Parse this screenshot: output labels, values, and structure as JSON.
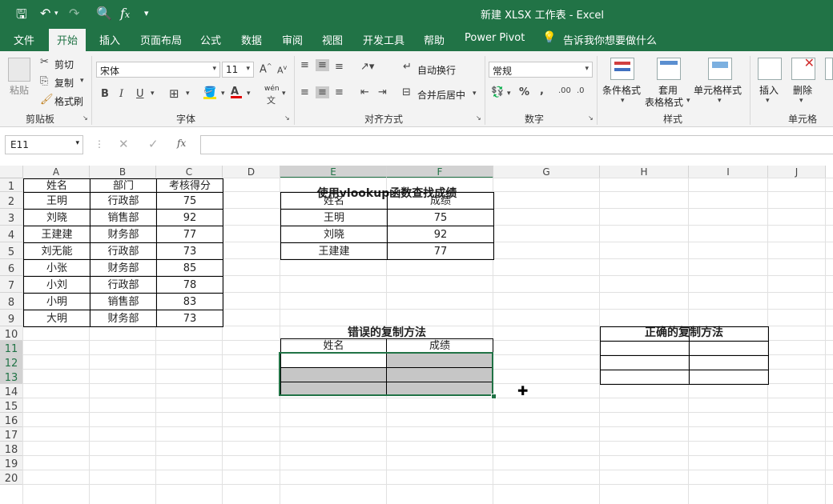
{
  "titlebar": {
    "title": "新建 XLSX 工作表  -  Excel",
    "icons": [
      "save-icon",
      "undo-icon",
      "redo-icon",
      "print-preview-icon",
      "fx-icon",
      "customize-icon"
    ]
  },
  "tabs": [
    "文件",
    "开始",
    "插入",
    "页面布局",
    "公式",
    "数据",
    "审阅",
    "视图",
    "开发工具",
    "帮助",
    "Power Pivot"
  ],
  "active_tab": "开始",
  "tell_me": "告诉我你想要做什么",
  "ribbon": {
    "clipboard": {
      "paste": "粘贴",
      "cut": "剪切",
      "copy": "复制",
      "format_painter": "格式刷",
      "group": "剪贴板"
    },
    "font": {
      "name": "宋体",
      "size": "11",
      "bold": "B",
      "italic": "I",
      "underline": "U",
      "wen": "wén",
      "group": "字体"
    },
    "alignment": {
      "wrap": "自动换行",
      "merge": "合并后居中",
      "group": "对齐方式"
    },
    "number": {
      "format": "常规",
      "percent": "%",
      "comma": ",",
      "inc_dec": ".00",
      "dec_dec": ".0",
      "group": "数字"
    },
    "styles": {
      "conditional": "条件格式",
      "table_fmt_1": "套用",
      "table_fmt_2": "表格格式",
      "cell_styles": "单元格样式",
      "group": "样式"
    },
    "cells": {
      "insert": "插入",
      "delete": "删除",
      "group": "单元格"
    }
  },
  "formula_bar": {
    "name_box": "E11",
    "fx": "fx",
    "value": ""
  },
  "columns": [
    "A",
    "B",
    "C",
    "D",
    "E",
    "F",
    "G",
    "H",
    "I",
    "J"
  ],
  "rows": [
    "1",
    "2",
    "3",
    "4",
    "5",
    "6",
    "7",
    "8",
    "9",
    "10",
    "11",
    "12",
    "13",
    "14",
    "15",
    "16",
    "17",
    "18",
    "19",
    "20"
  ],
  "table1": {
    "headers": [
      "姓名",
      "部门",
      "考核得分"
    ],
    "rows": [
      [
        "王明",
        "行政部",
        "75"
      ],
      [
        "刘晓",
        "销售部",
        "92"
      ],
      [
        "王建建",
        "财务部",
        "77"
      ],
      [
        "刘无能",
        "行政部",
        "73"
      ],
      [
        "小张",
        "财务部",
        "85"
      ],
      [
        "小刘",
        "行政部",
        "78"
      ],
      [
        "小明",
        "销售部",
        "83"
      ],
      [
        "大明",
        "财务部",
        "73"
      ]
    ]
  },
  "lookup_table": {
    "title": "使用vlookup函数查找成绩",
    "headers": [
      "姓名",
      "成绩"
    ],
    "rows": [
      [
        "王明",
        "75"
      ],
      [
        "刘晓",
        "92"
      ],
      [
        "王建建",
        "77"
      ]
    ]
  },
  "wrong_table": {
    "title": "错误的复制方法",
    "headers": [
      "姓名",
      "成绩"
    ]
  },
  "right_table": {
    "title": "正确的复制方法"
  }
}
